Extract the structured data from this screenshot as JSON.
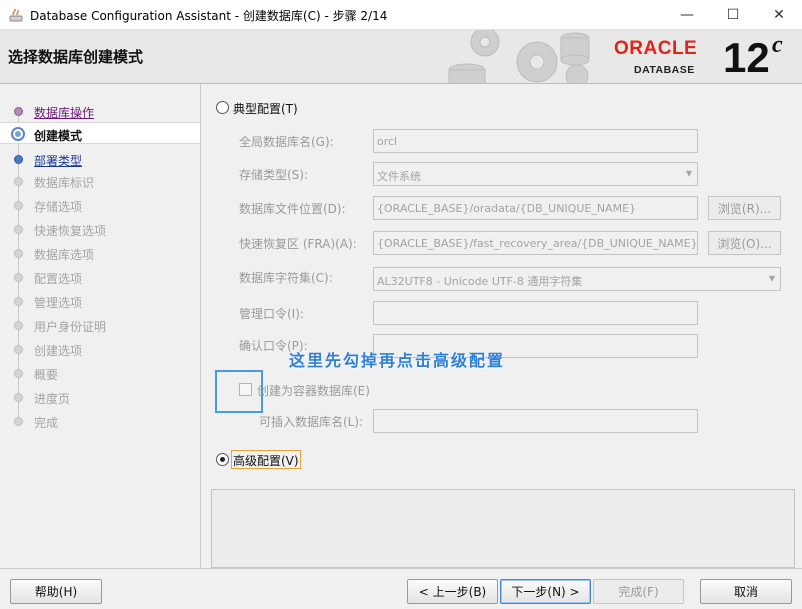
{
  "window": {
    "title": "Database Configuration Assistant - 创建数据库(C) - 步骤 2/14",
    "minimize": "—",
    "maximize": "☐",
    "close": "✕"
  },
  "banner": {
    "step_title": "选择数据库创建模式",
    "brand": "ORACLE",
    "brand_sub": "DATABASE",
    "version": "12",
    "version_sup": "c"
  },
  "sidebar": {
    "steps": [
      {
        "label": "数据库操作",
        "state": "done"
      },
      {
        "label": "创建模式",
        "state": "current"
      },
      {
        "label": "部署类型",
        "state": "link"
      },
      {
        "label": "数据库标识",
        "state": "pending"
      },
      {
        "label": "存储选项",
        "state": "pending"
      },
      {
        "label": "快速恢复选项",
        "state": "pending"
      },
      {
        "label": "数据库选项",
        "state": "pending"
      },
      {
        "label": "配置选项",
        "state": "pending"
      },
      {
        "label": "管理选项",
        "state": "pending"
      },
      {
        "label": "用户身份证明",
        "state": "pending"
      },
      {
        "label": "创建选项",
        "state": "pending"
      },
      {
        "label": "概要",
        "state": "pending"
      },
      {
        "label": "进度页",
        "state": "pending"
      },
      {
        "label": "完成",
        "state": "pending"
      }
    ]
  },
  "main": {
    "typical": {
      "label": "典型配置(T)",
      "checked": false,
      "global_db_name_label": "全局数据库名(G):",
      "global_db_name_value": "orcl",
      "storage_type_label": "存储类型(S):",
      "storage_type_value": "文件系统",
      "db_file_location_label": "数据库文件位置(D):",
      "db_file_location_value": "{ORACLE_BASE}/oradata/{DB_UNIQUE_NAME}",
      "browse_r_label": "浏览(R)...",
      "fra_label": "快速恢复区 (FRA)(A):",
      "fra_value": "{ORACLE_BASE}/fast_recovery_area/{DB_UNIQUE_NAME}",
      "browse_o_label": "浏览(O)...",
      "charset_label": "数据库字符集(C):",
      "charset_value": "AL32UTF8 - Unicode UTF-8 通用字符集",
      "admin_pwd_label": "管理口令(I):",
      "confirm_pwd_label": "确认口令(P):",
      "container_label": "创建为容器数据库(E)",
      "pluggable_label": "可插入数据库名(L):"
    },
    "annotation": "这里先勾掉再点击高级配置",
    "advanced": {
      "label": "高级配置(V)",
      "checked": true
    }
  },
  "footer": {
    "help": "帮助(H)",
    "back": "< 上一步(B)",
    "next": "下一步(N) >",
    "finish": "完成(F)",
    "cancel": "取消"
  },
  "colors": {
    "oracle_red": "#e2231a",
    "annotation_blue": "#2f7fd8",
    "visited_step": "#6a1b78",
    "link_step": "#1a3a9a"
  }
}
